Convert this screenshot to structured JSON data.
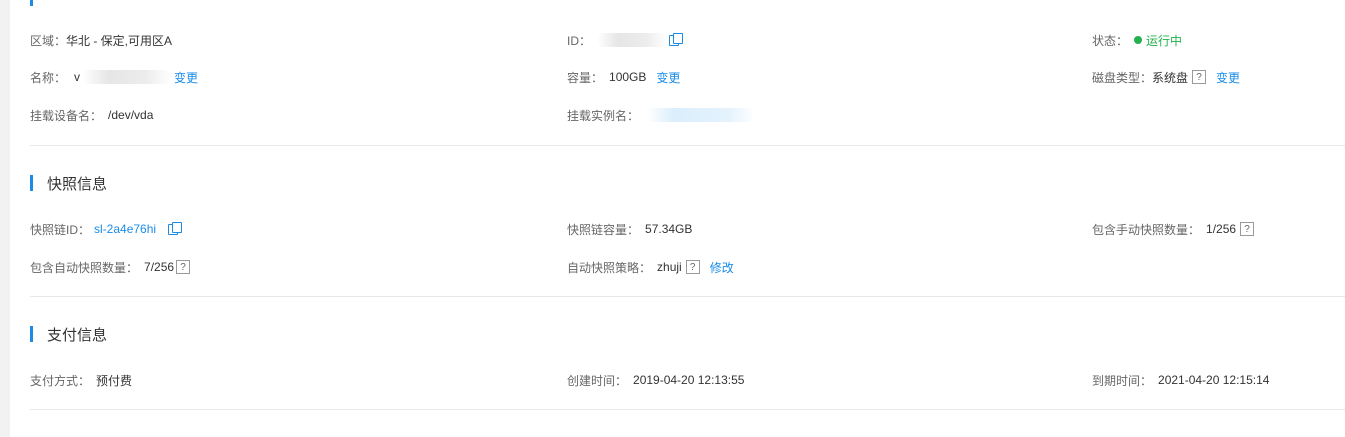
{
  "basic": {
    "region_label": "区域：",
    "region_value": "华北 - 保定,可用区A",
    "id_label": "ID：",
    "status_label": "状态：",
    "status_value": "运行中",
    "status_color": "#22b14c",
    "name_label": "名称：",
    "name_value": "v",
    "change_label": "变更",
    "capacity_label": "容量：",
    "capacity_value": "100GB",
    "disk_type_label": "磁盘类型：",
    "disk_type_value": "系统盘",
    "mount_device_label": "挂载设备名：",
    "mount_device_value": "/dev/vda",
    "mount_instance_label": "挂载实例名："
  },
  "snapshot": {
    "title": "快照信息",
    "chain_id_label": "快照链ID：",
    "chain_id_value": "sl-2a4e76hi",
    "chain_capacity_label": "快照链容量：",
    "chain_capacity_value": "57.34GB",
    "manual_count_label": "包含手动快照数量：",
    "manual_count_value": "1/256",
    "auto_count_label": "包含自动快照数量：",
    "auto_count_value": "7/256",
    "auto_policy_label": "自动快照策略：",
    "auto_policy_value": "zhuji",
    "modify_label": "修改"
  },
  "payment": {
    "title": "支付信息",
    "method_label": "支付方式：",
    "method_value": "预付费",
    "created_label": "创建时间：",
    "created_value": "2019-04-20 12:13:55",
    "expire_label": "到期时间：",
    "expire_value": "2021-04-20 12:15:14"
  },
  "help_glyph": "?",
  "accent_color": "#1a8ce8"
}
